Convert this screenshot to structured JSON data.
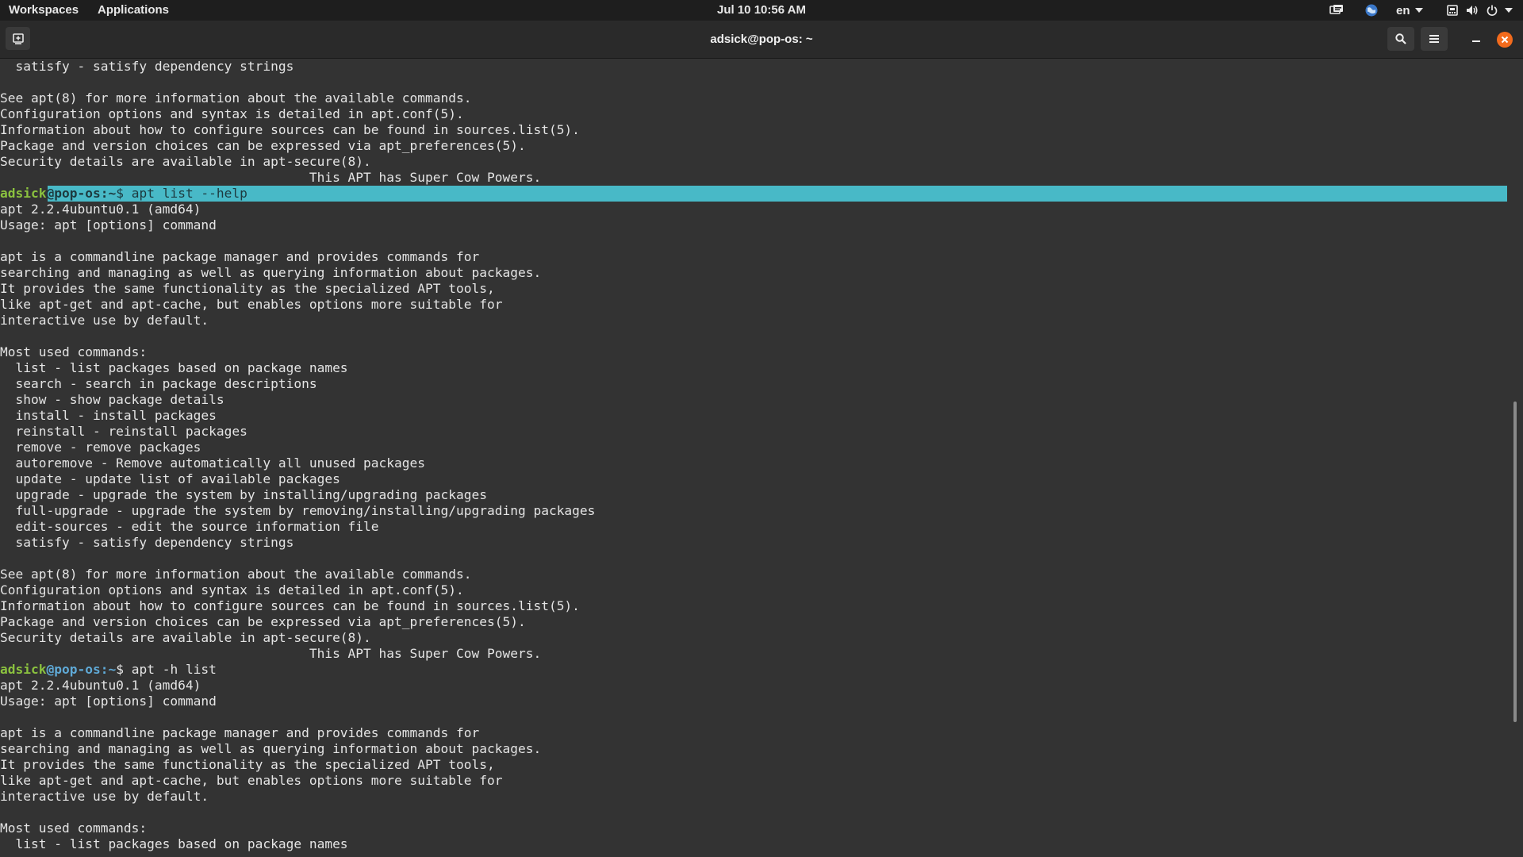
{
  "topbar": {
    "workspaces": "Workspaces",
    "applications": "Applications",
    "clock": "Jul 10  10:56 AM",
    "language": "en"
  },
  "window": {
    "title": "adsick@pop-os: ~"
  },
  "colors": {
    "prompt_user": "#8bc23f",
    "prompt_host": "#5fa9d6",
    "selection": "#48b9c7",
    "close_button": "#f26b1d",
    "terminal_bg": "#333333"
  },
  "terminal": {
    "lines": [
      "  satisfy - satisfy dependency strings",
      "",
      "See apt(8) for more information about the available commands.",
      "Configuration options and syntax is detailed in apt.conf(5).",
      "Information about how to configure sources can be found in sources.list(5).",
      "Package and version choices can be expressed via apt_preferences(5).",
      "Security details are available in apt-secure(8).",
      "                                        This APT has Super Cow Powers.",
      {
        "prompt": true,
        "user": "adsick",
        "host": "@pop-os",
        "path": ":~",
        "dollar": "$ ",
        "cmd": "apt list --help",
        "selected": true
      },
      "apt 2.2.4ubuntu0.1 (amd64)",
      "Usage: apt [options] command",
      "",
      "apt is a commandline package manager and provides commands for",
      "searching and managing as well as querying information about packages.",
      "It provides the same functionality as the specialized APT tools,",
      "like apt-get and apt-cache, but enables options more suitable for",
      "interactive use by default.",
      "",
      "Most used commands:",
      "  list - list packages based on package names",
      "  search - search in package descriptions",
      "  show - show package details",
      "  install - install packages",
      "  reinstall - reinstall packages",
      "  remove - remove packages",
      "  autoremove - Remove automatically all unused packages",
      "  update - update list of available packages",
      "  upgrade - upgrade the system by installing/upgrading packages",
      "  full-upgrade - upgrade the system by removing/installing/upgrading packages",
      "  edit-sources - edit the source information file",
      "  satisfy - satisfy dependency strings",
      "",
      "See apt(8) for more information about the available commands.",
      "Configuration options and syntax is detailed in apt.conf(5).",
      "Information about how to configure sources can be found in sources.list(5).",
      "Package and version choices can be expressed via apt_preferences(5).",
      "Security details are available in apt-secure(8).",
      "                                        This APT has Super Cow Powers.",
      {
        "prompt": true,
        "user": "adsick",
        "host": "@pop-os",
        "path": ":~",
        "dollar": "$ ",
        "cmd": "apt -h list",
        "selected": false
      },
      "apt 2.2.4ubuntu0.1 (amd64)",
      "Usage: apt [options] command",
      "",
      "apt is a commandline package manager and provides commands for",
      "searching and managing as well as querying information about packages.",
      "It provides the same functionality as the specialized APT tools,",
      "like apt-get and apt-cache, but enables options more suitable for",
      "interactive use by default.",
      "",
      "Most used commands:",
      "  list - list packages based on package names"
    ]
  }
}
